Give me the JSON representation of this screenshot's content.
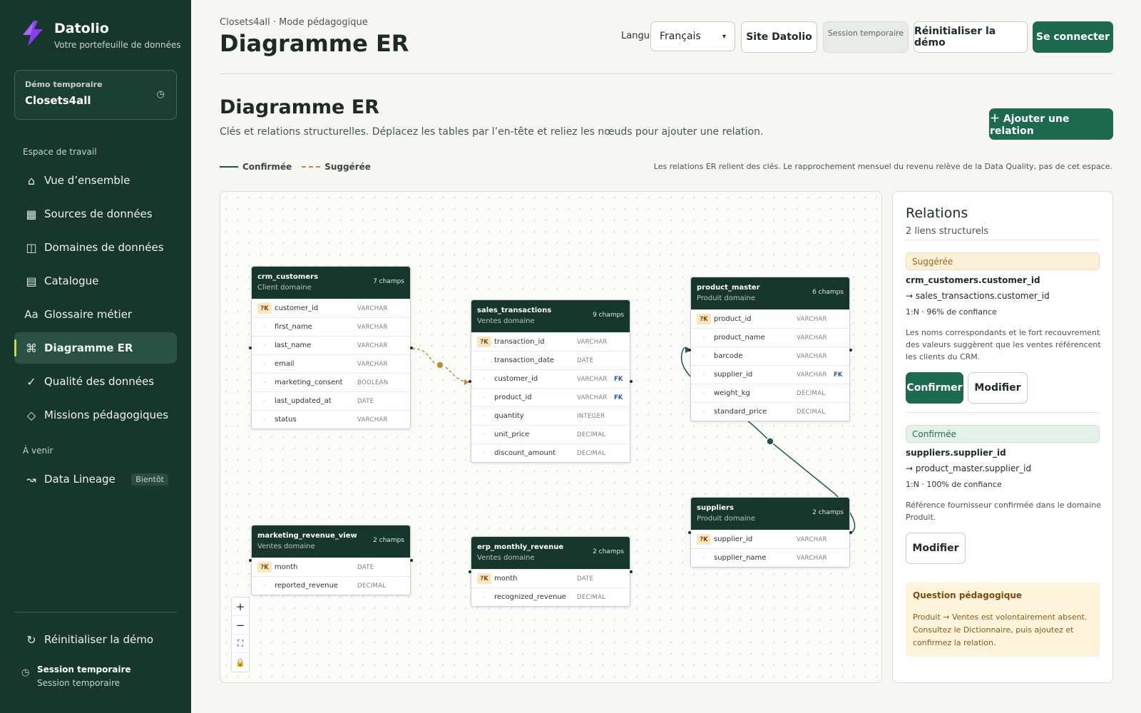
{
  "brand": {
    "name": "Datolio",
    "subtitle": "Votre portefeuille de données"
  },
  "demo": {
    "label": "Démo temporaire",
    "value": "Closets4all"
  },
  "sidebar": {
    "section_workspace": "Espace de travail",
    "items": [
      {
        "label": "Vue d’ensemble",
        "icon": "home-icon"
      },
      {
        "label": "Sources de données",
        "icon": "grid-icon"
      },
      {
        "label": "Domaines de données",
        "icon": "columns-icon"
      },
      {
        "label": "Catalogue",
        "icon": "list-icon"
      },
      {
        "label": "Glossaire métier",
        "icon": "text-icon"
      },
      {
        "label": "Diagramme ER",
        "icon": "command-icon",
        "active": true
      },
      {
        "label": "Qualité des données",
        "icon": "check-icon"
      },
      {
        "label": "Missions pédagogiques",
        "icon": "diamond-icon"
      }
    ],
    "section_upcoming": "À venir",
    "upcoming": {
      "label": "Data Lineage",
      "badge": "Bientôt"
    },
    "reset": "Réinitialiser la démo",
    "session_title": "Session temporaire",
    "session_sub": "Session temporaire"
  },
  "header": {
    "breadcrumb": "Closets4all · Mode pédagogique",
    "title": "Diagramme ER",
    "lang_label": "Langue",
    "lang_value": "Français",
    "site_button": "Site Datolio",
    "session_pill": "Session temporaire",
    "reset_button": "Réinitialiser la démo",
    "login_button": "Se connecter"
  },
  "main": {
    "title": "Diagramme ER",
    "description": "Clés et relations structurelles. Déplacez les tables par l’en-tête et reliez les nœuds pour ajouter une relation.",
    "add_button": "＋ Ajouter une relation",
    "legend_confirmed": "Confirmée",
    "legend_suggested": "Suggérée",
    "note": "Les relations ER relient des clés. Le rapprochement mensuel du revenu relève de la Data Quality, pas de cet espace."
  },
  "tables": [
    {
      "name": "crm_customers",
      "domain": "Client domaine",
      "count": "7 champs",
      "fields": [
        {
          "key": "?K",
          "name": "customer_id",
          "type": "VARCHAR"
        },
        {
          "name": "first_name",
          "type": "VARCHAR"
        },
        {
          "name": "last_name",
          "type": "VARCHAR"
        },
        {
          "name": "email",
          "type": "VARCHAR"
        },
        {
          "name": "marketing_consent",
          "type": "BOOLEAN"
        },
        {
          "name": "last_updated_at",
          "type": "DATE"
        },
        {
          "name": "status",
          "type": "VARCHAR"
        }
      ]
    },
    {
      "name": "sales_transactions",
      "domain": "Ventes domaine",
      "count": "9 champs",
      "fields": [
        {
          "key": "?K",
          "name": "transaction_id",
          "type": "VARCHAR"
        },
        {
          "name": "transaction_date",
          "type": "DATE"
        },
        {
          "name": "customer_id",
          "type": "VARCHAR",
          "fk": "FK"
        },
        {
          "name": "product_id",
          "type": "VARCHAR",
          "fk": "FK"
        },
        {
          "name": "quantity",
          "type": "INTEGER"
        },
        {
          "name": "unit_price",
          "type": "DECIMAL"
        },
        {
          "name": "discount_amount",
          "type": "DECIMAL"
        }
      ]
    },
    {
      "name": "product_master",
      "domain": "Produit domaine",
      "count": "6 champs",
      "fields": [
        {
          "key": "?K",
          "name": "product_id",
          "type": "VARCHAR"
        },
        {
          "name": "product_name",
          "type": "VARCHAR"
        },
        {
          "name": "barcode",
          "type": "VARCHAR"
        },
        {
          "name": "supplier_id",
          "type": "VARCHAR",
          "fk": "FK"
        },
        {
          "name": "weight_kg",
          "type": "DECIMAL"
        },
        {
          "name": "standard_price",
          "type": "DECIMAL"
        }
      ]
    },
    {
      "name": "suppliers",
      "domain": "Produit domaine",
      "count": "2 champs",
      "fields": [
        {
          "key": "?K",
          "name": "supplier_id",
          "type": "VARCHAR"
        },
        {
          "name": "supplier_name",
          "type": "VARCHAR"
        }
      ]
    },
    {
      "name": "marketing_revenue_view",
      "domain": "Ventes domaine",
      "count": "2 champs",
      "fields": [
        {
          "key": "?K",
          "name": "month",
          "type": "DATE"
        },
        {
          "name": "reported_revenue",
          "type": "DECIMAL"
        }
      ]
    },
    {
      "name": "erp_monthly_revenue",
      "domain": "Ventes domaine",
      "count": "2 champs",
      "fields": [
        {
          "key": "?K",
          "name": "month",
          "type": "DATE"
        },
        {
          "name": "recognized_revenue",
          "type": "DECIMAL"
        }
      ]
    }
  ],
  "zoom": {
    "plus": "+",
    "minus": "−",
    "fit": "⛶",
    "lock": "🔒"
  },
  "panel": {
    "title": "Relations",
    "subtitle": "2 liens structurels",
    "relations": [
      {
        "status": "Suggérée",
        "from": "crm_customers.customer_id",
        "to": "→ sales_transactions.customer_id",
        "card": "1:N · 96% de confiance",
        "desc": "Les noms correspondants et le fort recouvrement des valeurs suggèrent que les ventes référencent les clients du CRM.",
        "confirm": "Confirmer",
        "edit": "Modifier"
      },
      {
        "status": "Confirmée",
        "from": "suppliers.supplier_id",
        "to": "→ product_master.supplier_id",
        "card": "1:N · 100% de confiance",
        "desc": "Référence fournisseur confirmée dans le domaine Produit.",
        "edit": "Modifier"
      }
    ],
    "question_title": "Question pédagogique",
    "question_text": "Produit → Ventes est volontairement absent. Consultez le Dictionnaire, puis ajoutez et confirmez la relation."
  },
  "colors": {
    "sidebar": "#17372d",
    "accent": "#1d6a4f",
    "suggested": "#c38b33"
  }
}
